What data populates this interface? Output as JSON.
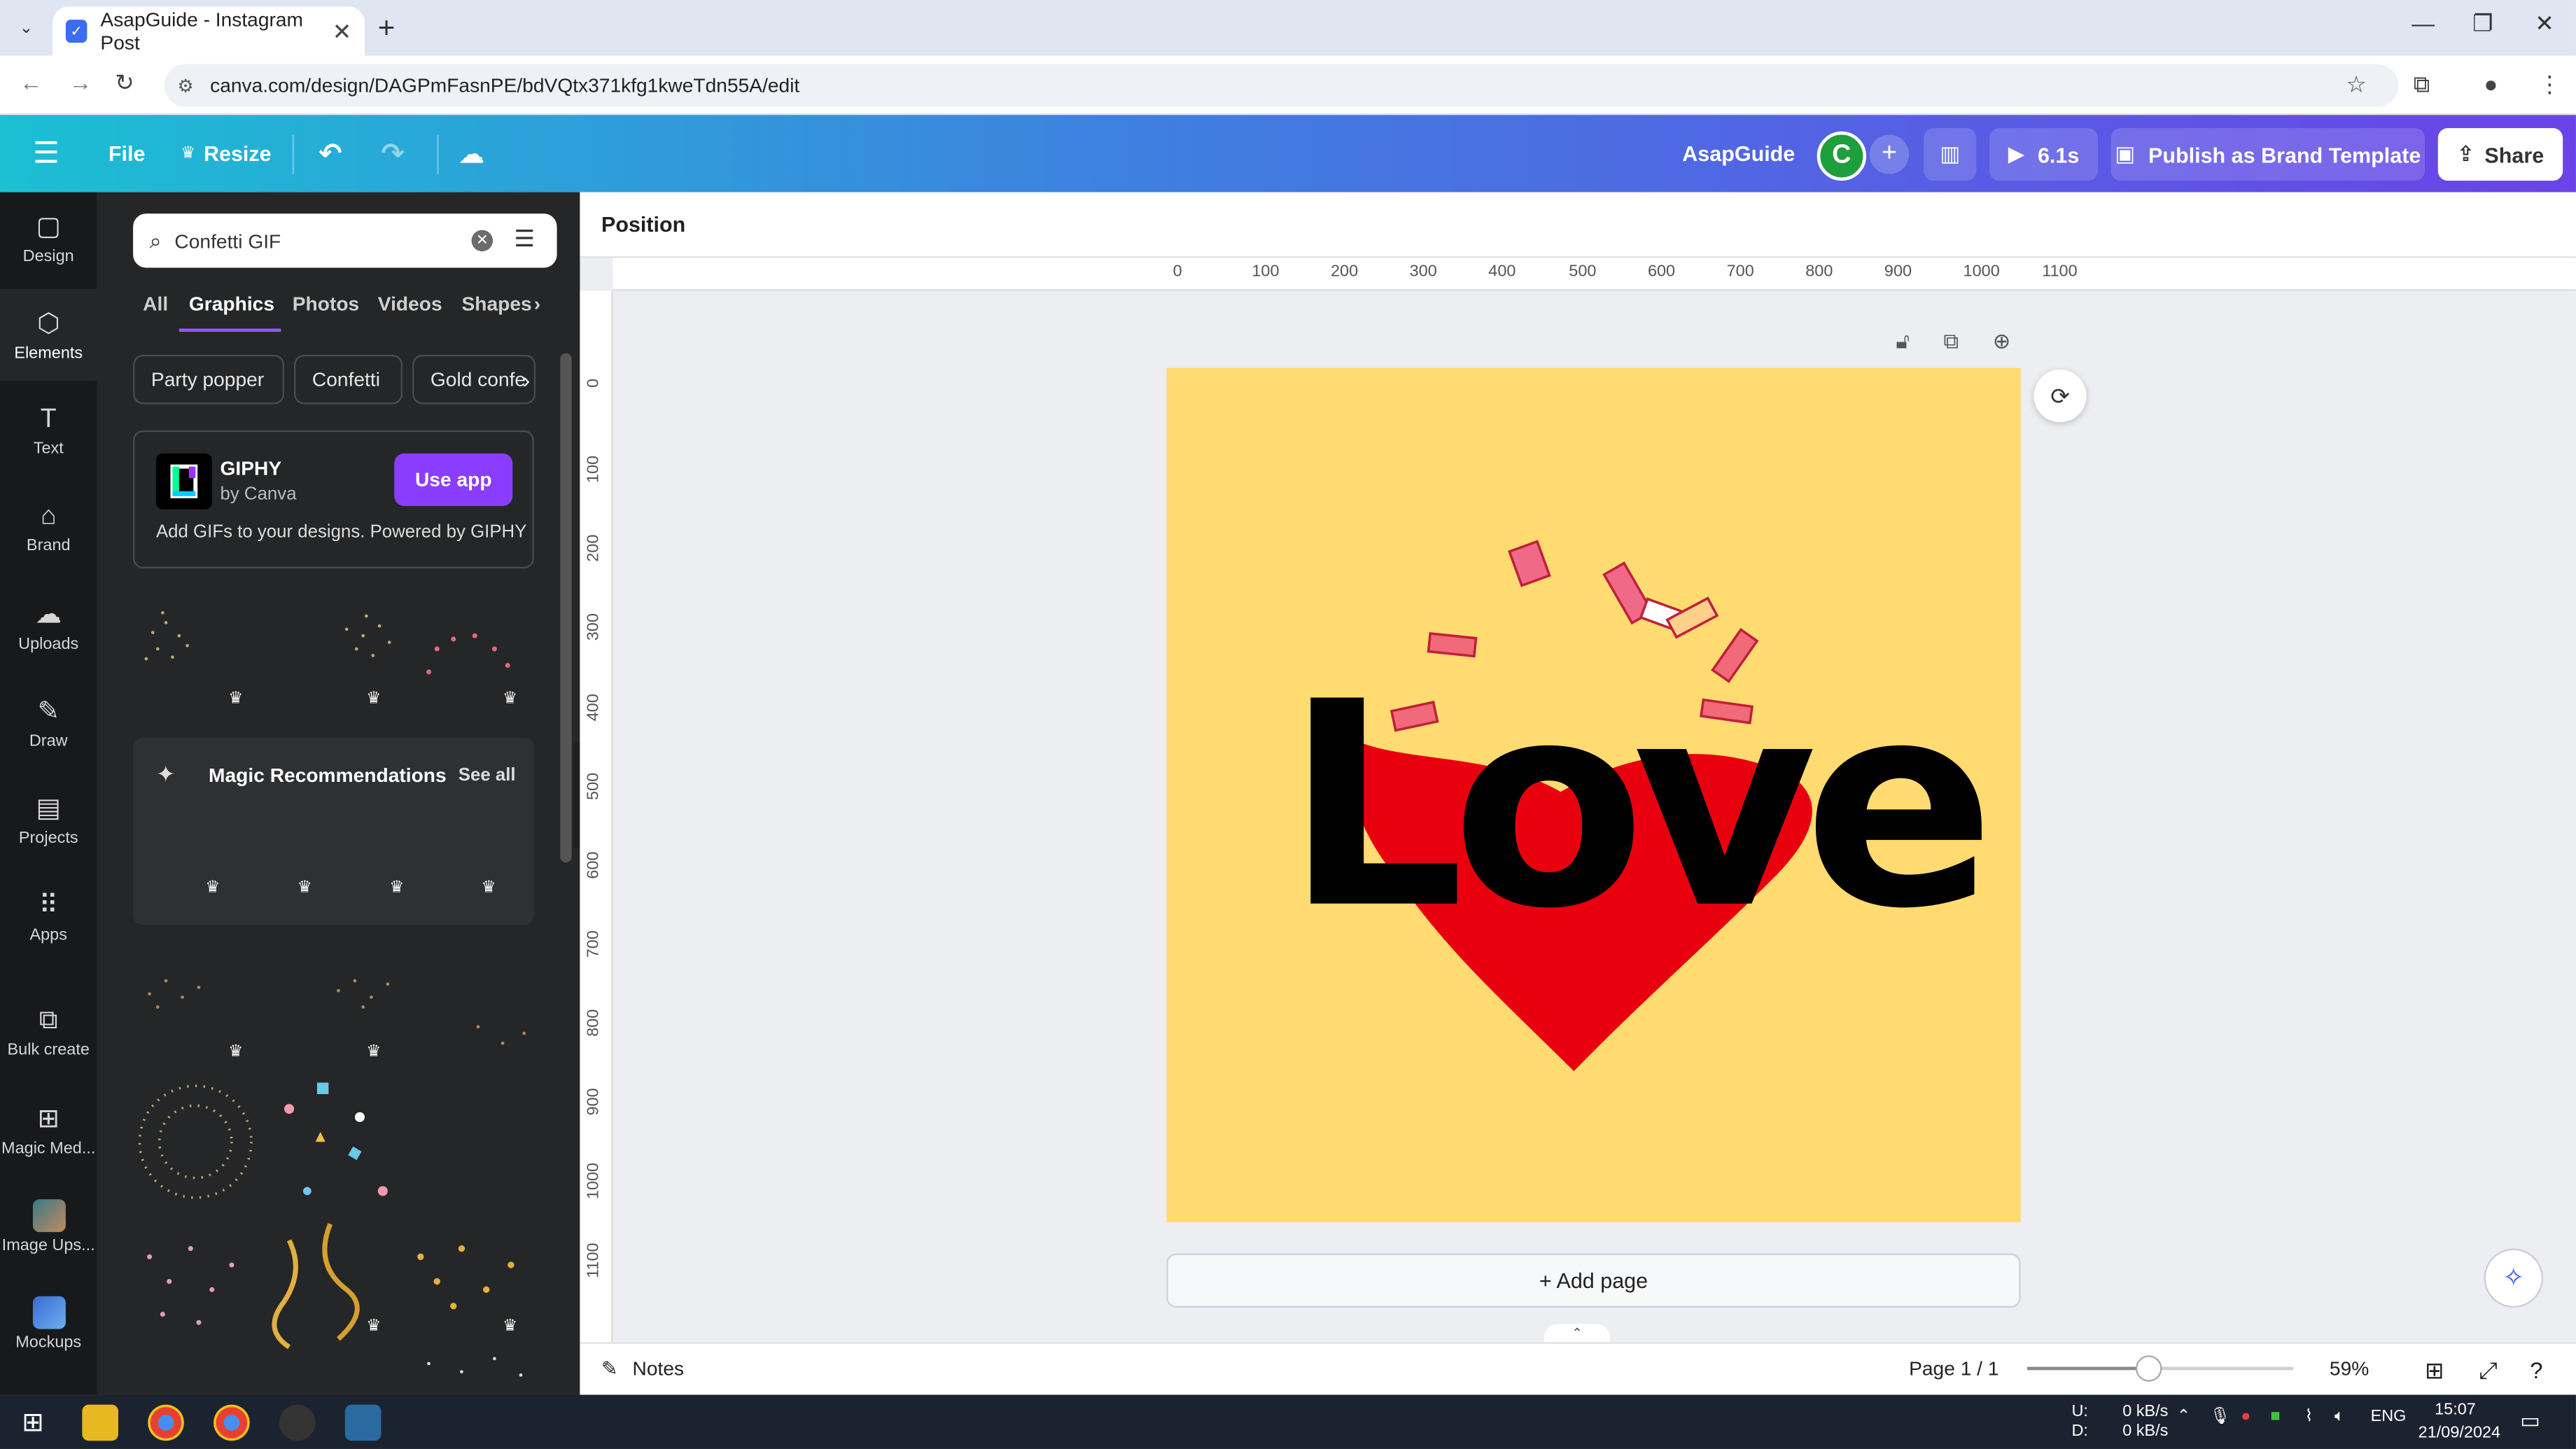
{
  "browser": {
    "tab_title": "AsapGuide - Instagram Post",
    "url": "canva.com/design/DAGPmFasnPE/bdVQtx371kfg1kweTdn55A/edit"
  },
  "header": {
    "file_label": "File",
    "resize_label": "Resize",
    "brand_name": "AsapGuide",
    "avatar_initial": "C",
    "play_label": "6.1s",
    "publish_label": "Publish as Brand Template",
    "share_label": "Share",
    "brand_color": "#8b3dff"
  },
  "rail": {
    "items": [
      {
        "label": "Design",
        "icon": "design-icon"
      },
      {
        "label": "Elements",
        "icon": "elements-icon"
      },
      {
        "label": "Text",
        "icon": "text-icon"
      },
      {
        "label": "Brand",
        "icon": "brand-icon"
      },
      {
        "label": "Uploads",
        "icon": "uploads-icon"
      },
      {
        "label": "Draw",
        "icon": "draw-icon"
      },
      {
        "label": "Projects",
        "icon": "projects-icon"
      },
      {
        "label": "Apps",
        "icon": "apps-icon"
      },
      {
        "label": "Bulk create",
        "icon": "bulk-create-icon"
      },
      {
        "label": "Magic Med...",
        "icon": "magic-media-icon"
      },
      {
        "label": "Image Ups...",
        "icon": "image-upscaler-icon"
      },
      {
        "label": "Mockups",
        "icon": "mockups-icon"
      }
    ],
    "active": "Elements"
  },
  "panel": {
    "search_value": "Confetti GIF",
    "tabs": [
      "All",
      "Graphics",
      "Photos",
      "Videos",
      "Shapes"
    ],
    "active_tab": "Graphics",
    "chips": [
      "Party popper",
      "Confetti",
      "Gold confe"
    ],
    "giphy": {
      "title": "GIPHY",
      "by": "by Canva",
      "button": "Use app",
      "description": "Add GIFs to your designs. Powered by GIPHY"
    },
    "magic": {
      "title": "Magic Recommendations",
      "see_all": "See all"
    }
  },
  "editor": {
    "position_label": "Position",
    "hruler": [
      "0",
      "100",
      "200",
      "300",
      "400",
      "500",
      "600",
      "700",
      "800",
      "900",
      "1000",
      "1100"
    ],
    "vruler": [
      "0",
      "100",
      "200",
      "300",
      "400",
      "500",
      "600",
      "700",
      "800",
      "900",
      "1000",
      "1100"
    ],
    "canvas_text": "Love",
    "canvas_bg": "#ffdb71",
    "heart_color": "#e8000f",
    "add_page_label": "+ Add page"
  },
  "statusbar": {
    "notes_label": "Notes",
    "page_label": "Page 1 / 1",
    "zoom_label": "59%",
    "zoom_fraction": 0.59
  },
  "taskbar": {
    "upload_speed": "0 kB/s",
    "download_speed": "0 kB/s",
    "up_label": "U:",
    "down_label": "D:",
    "language": "ENG",
    "time": "15:07",
    "date": "21/09/2024"
  }
}
